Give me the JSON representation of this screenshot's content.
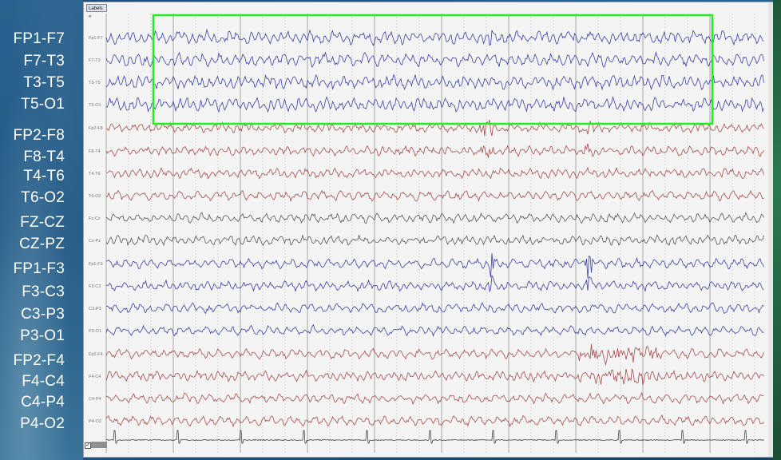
{
  "montage_labels": [
    "FP1-F7",
    "F7-T3",
    "T3-T5",
    "T5-O1",
    "FP2-F8",
    "F8-T4",
    "T4-T6",
    "T6-O2",
    "FZ-CZ",
    "CZ-PZ",
    "FP1-F3",
    "F3-C3",
    "C3-P3",
    "P3-O1",
    "FP2-F4",
    "F4-C4",
    "C4-P4",
    "P4-O2"
  ],
  "viewer": {
    "labels_header": "Labels «",
    "row_labels": [
      "Fp1-F7",
      "F7-T3",
      "T3-T5",
      "T5-O1",
      "Fp2-F8",
      "F8-T4",
      "T4-T6",
      "T6-O2",
      "Fz-Cz",
      "Cz-Pz",
      "Fp1-F3",
      "F3-C3",
      "C3-P3",
      "P3-O1",
      "Fp2-F4",
      "F4-C4",
      "C4-P4",
      "P4-O2"
    ],
    "ruler_check": "✓"
  },
  "colors": {
    "left_chain": "#3b3ea8",
    "right_chain": "#a84a4a",
    "midline": "#555555",
    "ekg": "#444444",
    "highlight": "#22ee22",
    "grid": "#bdbdbd"
  },
  "icons": [
    "labels-collapse-icon",
    "checkbox-icon"
  ]
}
